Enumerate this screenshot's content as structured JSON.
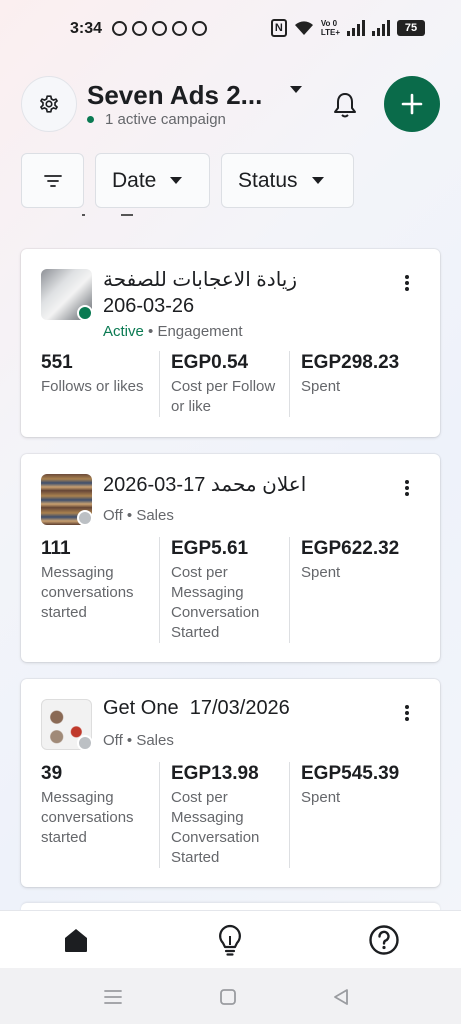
{
  "status_bar": {
    "time": "3:34",
    "battery": "75",
    "nfc": "N",
    "volte_line1": "Vo 0",
    "volte_line2": "LTE+"
  },
  "header": {
    "account_title": "Seven Ads 2...",
    "campaign_count": "1 active campaign"
  },
  "filters": {
    "date_label": "Date",
    "status_label": "Status"
  },
  "campaigns": [
    {
      "name_line1": "زيادة الاعجابات للصفحة",
      "name_line2": "206-03-26",
      "status": "Active",
      "objective": "Engagement",
      "status_color": "#0a7a52",
      "metrics": [
        {
          "value": "551",
          "label": "Follows or likes"
        },
        {
          "value": "EGP0.54",
          "label": "Cost per Follow or like"
        },
        {
          "value": "EGP298.23",
          "label": "Spent"
        }
      ]
    },
    {
      "name_line1": "اعلان محمد 17-03-2026",
      "status": "Off",
      "objective": "Sales",
      "status_color": "#bcc0c4",
      "metrics": [
        {
          "value": "111",
          "label": "Messaging conversations started"
        },
        {
          "value": "EGP5.61",
          "label": "Cost per Messaging Conversation Started"
        },
        {
          "value": "EGP622.32",
          "label": "Spent"
        }
      ]
    },
    {
      "name_line1": "Get One  17/03/2026",
      "status": "Off",
      "objective": "Sales",
      "status_color": "#bcc0c4",
      "metrics": [
        {
          "value": "39",
          "label": "Messaging conversations started"
        },
        {
          "value": "EGP13.98",
          "label": "Cost per Messaging Conversation Started"
        },
        {
          "value": "EGP545.39",
          "label": "Spent"
        }
      ]
    }
  ],
  "bottom_nav": {
    "items": [
      "home-icon",
      "lightbulb-icon",
      "help-icon"
    ]
  },
  "colors": {
    "brand_green": "#0a6b4a",
    "active_green": "#0a7a52",
    "off_gray": "#bcc0c4"
  }
}
